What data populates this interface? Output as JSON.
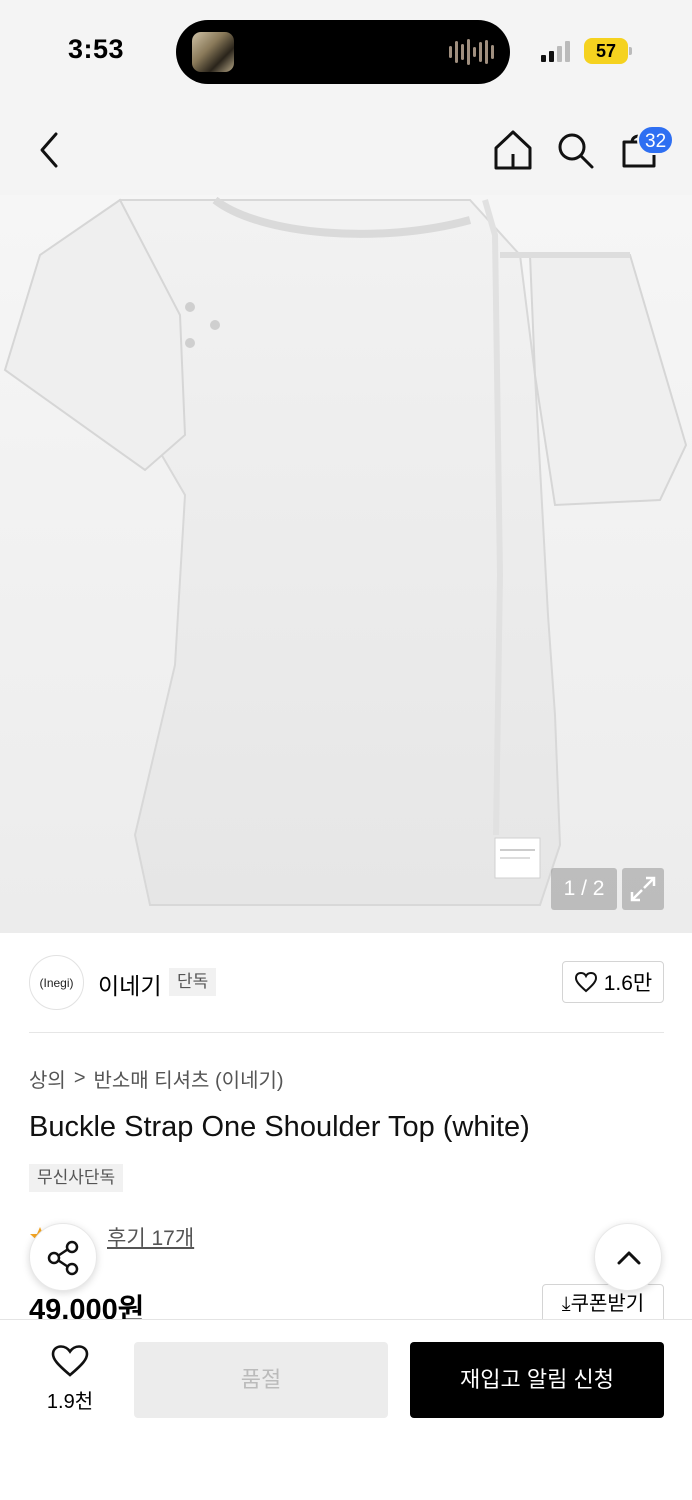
{
  "status_bar": {
    "time": "3:53",
    "battery": "57"
  },
  "nav": {
    "cart_count": "32"
  },
  "gallery": {
    "counter": "1 / 2"
  },
  "brand": {
    "logo_text": "(Inegi)",
    "name": "이네기",
    "exclusive_tag": "단독",
    "likes": "1.6만"
  },
  "breadcrumb": {
    "level1": "상의",
    "separator": ">",
    "level2": "반소매 티셔츠 (이네기)"
  },
  "product": {
    "title": "Buckle Strap One Shoulder Top (white)",
    "musinsa_tag": "무신사단독",
    "review_label": "후기 17개",
    "price": "49,000원",
    "coupon_label": "쿠폰받기"
  },
  "bottom": {
    "wish_count": "1.9천",
    "soldout_label": "품절",
    "restock_label": "재입고 알림 신청"
  },
  "colors": {
    "accent_blue": "#2e6ff2",
    "battery_yellow": "#f5d21f",
    "star": "#f5a623"
  }
}
